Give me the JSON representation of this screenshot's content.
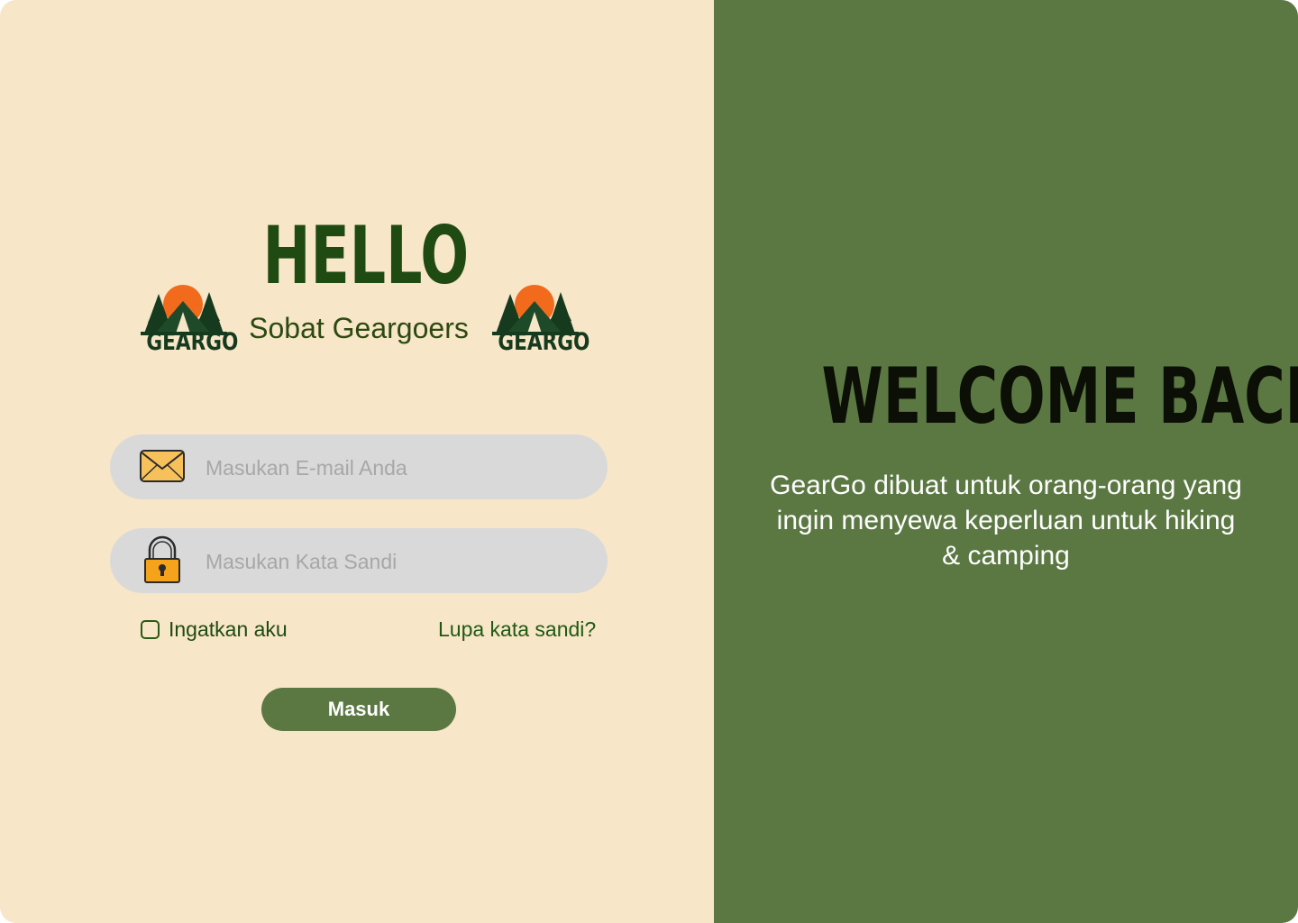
{
  "left_panel": {
    "logo_text": "GEARGO",
    "heading": "HELLO",
    "subtitle": "Sobat Geargoers",
    "email": {
      "placeholder": "Masukan E-mail Anda",
      "value": ""
    },
    "password": {
      "placeholder": "Masukan Kata Sandi",
      "value": ""
    },
    "remember": {
      "label": "Ingatkan aku",
      "checked": false
    },
    "forgot_label": "Lupa kata sandi?",
    "login_label": "Masuk"
  },
  "right_panel": {
    "heading": "WELCOME BACK",
    "tagline": "GearGo dibuat untuk orang-orang yang ingin menyewa keperluan untuk hiking & camping"
  },
  "colors": {
    "cream_bg": "#f7e6c8",
    "green_panel": "#5b7843",
    "dark_green_text": "#1f4a12",
    "field_bg": "#d9d9d9",
    "sun_orange": "#f26a1b"
  },
  "icons": {
    "email": "envelope-icon",
    "password": "padlock-icon",
    "logo": "tent-mountain-logo"
  }
}
